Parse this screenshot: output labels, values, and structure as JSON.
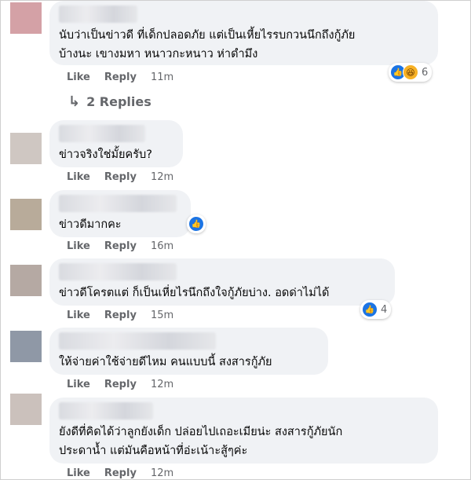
{
  "comments": [
    {
      "text": "นับว่าเป็นข่าวดี ที่เด็กปลอดภัย แต่เป็นเหี้ยไรรบกวนนึกถึงกู้ภัย\nบ้างนะ เขางมหา หนาวกะหนาว ห่าดำมึง",
      "like": "Like",
      "reply": "Reply",
      "time": "11m",
      "reaction_count": "6",
      "avatar_color": "#d4a1a6"
    },
    {
      "text": "ข่าวจริงใช่มั้ยครับ?",
      "like": "Like",
      "reply": "Reply",
      "time": "12m",
      "avatar_color": "#cfc7c2"
    },
    {
      "text": "ข่าวดีมากคะ",
      "like": "Like",
      "reply": "Reply",
      "time": "16m",
      "avatar_color": "#b8ab9a"
    },
    {
      "text": "ข่าวดีโครตแต่ ก็เป็นเหี่ยไรนึกถึงใจกู้ภัยบ่าง. อดด่าไม่ได้",
      "like": "Like",
      "reply": "Reply",
      "time": "15m",
      "reaction_count": "4",
      "avatar_color": "#b5a9a3"
    },
    {
      "text": "ให้จ่ายค่าใช้จ่ายดีไหม คนแบบนี้ สงสารกู้ภัย",
      "like": "Like",
      "reply": "Reply",
      "time": "12m",
      "avatar_color": "#8f98a6"
    },
    {
      "text": "ยังดีที่คิดได้ว่าลูกยังเด็ก ปล่อยไปเถอะเมียน่ะ สงสารกู้ภัยนัก\nประดาน้ำ แต่มันคือหน้าที่อ่ะเน้าะสู้ๆค่ะ",
      "like": "Like",
      "reply": "Reply",
      "time": "12m",
      "avatar_color": "#cbc1bc"
    }
  ],
  "replies_label": "2 Replies",
  "colors": {
    "like_blue": "#1b74e4",
    "haha_yellow": "#f7b125",
    "bubble_gray": "#f0f2f5",
    "meta_gray": "#65676b"
  }
}
